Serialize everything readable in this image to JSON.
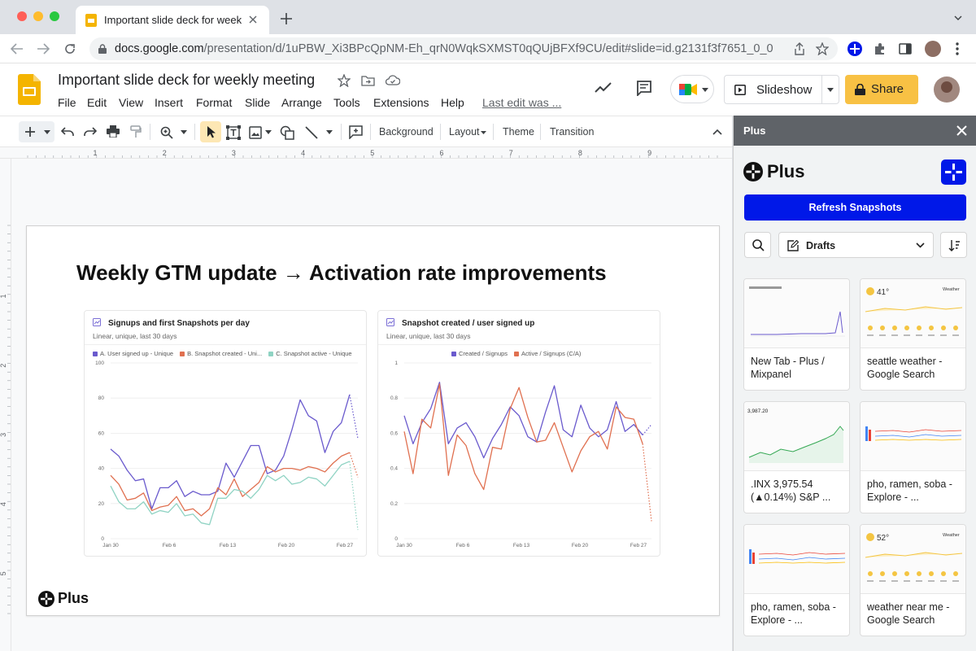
{
  "browser": {
    "tab_title": "Important slide deck for weekly meeting",
    "url_domain": "docs.google.com",
    "url_path": "/presentation/d/1uPBW_Xi3BPcQpNM-Eh_qrN0WqkSXMST0qQUjBFXf9CU/edit#slide=id.g2131f3f7651_0_0"
  },
  "app": {
    "doc_title": "Important slide deck for weekly meeting",
    "menu": [
      "File",
      "Edit",
      "View",
      "Insert",
      "Format",
      "Slide",
      "Arrange",
      "Tools",
      "Extensions",
      "Help"
    ],
    "last_edit": "Last edit was ...",
    "slideshow_label": "Slideshow",
    "share_label": "Share"
  },
  "toolbar": {
    "background_label": "Background",
    "layout_label": "Layout",
    "theme_label": "Theme",
    "transition_label": "Transition"
  },
  "ruler": {
    "h_labels": [
      "1",
      "2",
      "3",
      "4",
      "5",
      "6",
      "7",
      "8",
      "9"
    ],
    "v_labels": [
      "1",
      "2",
      "3",
      "4",
      "5"
    ]
  },
  "slide": {
    "title": "Weekly GTM update → Activation rate improvements",
    "logo_text": "Plus"
  },
  "chart_data": [
    {
      "type": "line",
      "title": "Signups and first Snapshots per day",
      "subtitle": "Linear, unique, last 30 days",
      "x": [
        "Jan 30",
        "Feb 6",
        "Feb 13",
        "Feb 20",
        "Feb 27"
      ],
      "ylim": [
        0,
        100
      ],
      "yticks": [
        "0",
        "20",
        "40",
        "60",
        "80",
        "100"
      ],
      "series": [
        {
          "name": "A. User signed up - Unique",
          "color": "#6a5acd",
          "values": [
            51,
            47,
            39,
            33,
            34,
            17,
            29,
            29,
            33,
            24,
            27,
            25,
            25,
            27,
            43,
            35,
            44,
            53,
            53,
            37,
            39,
            47,
            62,
            79,
            70,
            67,
            49,
            61,
            66,
            82,
            57
          ]
        },
        {
          "name": "B. Snapshot created - Uni...",
          "color": "#e07050",
          "values": [
            36,
            31,
            22,
            23,
            26,
            16,
            18,
            19,
            24,
            16,
            17,
            13,
            17,
            29,
            25,
            34,
            24,
            28,
            32,
            41,
            38,
            40,
            40,
            39,
            41,
            40,
            38,
            43,
            47,
            49,
            35
          ]
        },
        {
          "name": "C. Snapshot active - Unique",
          "color": "#8fd3c3",
          "values": [
            30,
            21,
            17,
            17,
            21,
            14,
            16,
            15,
            20,
            13,
            14,
            9,
            8,
            23,
            23,
            28,
            27,
            23,
            28,
            36,
            33,
            36,
            31,
            32,
            35,
            34,
            30,
            36,
            42,
            44,
            5
          ]
        }
      ]
    },
    {
      "type": "line",
      "title": "Snapshot created / user signed up",
      "subtitle": "Linear, unique, last 30 days",
      "x": [
        "Jan 30",
        "Feb 6",
        "Feb 13",
        "Feb 20",
        "Feb 27"
      ],
      "ylim": [
        0,
        1
      ],
      "yticks": [
        "0",
        "0.2",
        "0.4",
        "0.6",
        "0.8",
        "1"
      ],
      "series": [
        {
          "name": "Created / Signups",
          "color": "#6a5acd",
          "values": [
            0.7,
            0.54,
            0.66,
            0.74,
            0.89,
            0.54,
            0.63,
            0.66,
            0.58,
            0.46,
            0.57,
            0.65,
            0.75,
            0.7,
            0.58,
            0.55,
            0.72,
            0.87,
            0.62,
            0.58,
            0.76,
            0.63,
            0.58,
            0.62,
            0.78,
            0.61,
            0.65,
            0.59,
            0.65
          ]
        },
        {
          "name": "Active / Signups (C/A)",
          "color": "#e07050",
          "values": [
            0.61,
            0.37,
            0.68,
            0.63,
            0.88,
            0.36,
            0.59,
            0.53,
            0.37,
            0.28,
            0.52,
            0.51,
            0.74,
            0.86,
            0.69,
            0.55,
            0.56,
            0.66,
            0.52,
            0.38,
            0.5,
            0.58,
            0.61,
            0.51,
            0.75,
            0.69,
            0.68,
            0.54,
            0.1
          ]
        }
      ]
    }
  ],
  "panel": {
    "header": "Plus",
    "logo_text": "Plus",
    "refresh_label": "Refresh Snapshots",
    "filter_value": "Drafts",
    "snapshots": [
      {
        "caption": "New Tab - Plus / Mixpanel",
        "thumb": "line-spike"
      },
      {
        "caption": "seattle weather - Google Search",
        "thumb": "weather"
      },
      {
        "caption": ".INX 3,975.54 (▲0.14%) S&P ...",
        "thumb": "stock"
      },
      {
        "caption": "pho, ramen, soba - Explore - ...",
        "thumb": "trends"
      },
      {
        "caption": "pho, ramen, soba - Explore - ...",
        "thumb": "trends"
      },
      {
        "caption": "weather near me - Google Search",
        "thumb": "weather"
      }
    ],
    "thumb_text": {
      "stock_value": "3,987.20",
      "weather_temps": [
        "41°",
        "52°"
      ],
      "weather_label": "Weather"
    }
  }
}
